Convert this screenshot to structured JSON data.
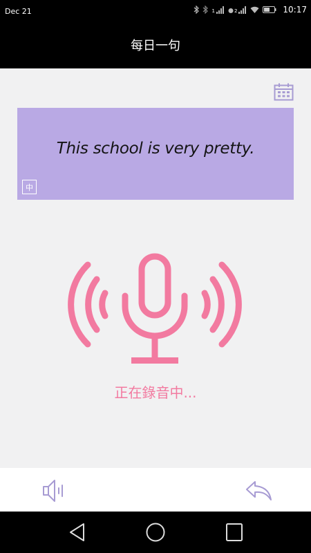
{
  "status_bar": {
    "date": "Dec 21",
    "time": "10:17",
    "sim1_label": "1",
    "sim2_label": "2"
  },
  "header": {
    "title": "每日一句"
  },
  "sentence_card": {
    "sentence": "This school is very pretty.",
    "translate_label": "中"
  },
  "recording": {
    "status": "正在錄音中..."
  },
  "icons": {
    "calendar": "calendar-icon",
    "microphone": "microphone-icon",
    "speaker": "speaker-icon",
    "reply": "reply-icon",
    "nav_back": "back-triangle-icon",
    "nav_home": "home-circle-icon",
    "nav_recents": "recents-square-icon"
  },
  "colors": {
    "accent_purple": "#b9a9e4",
    "icon_purple": "#a79bd3",
    "record_pink": "#f27aa0",
    "header_black": "#000000"
  }
}
